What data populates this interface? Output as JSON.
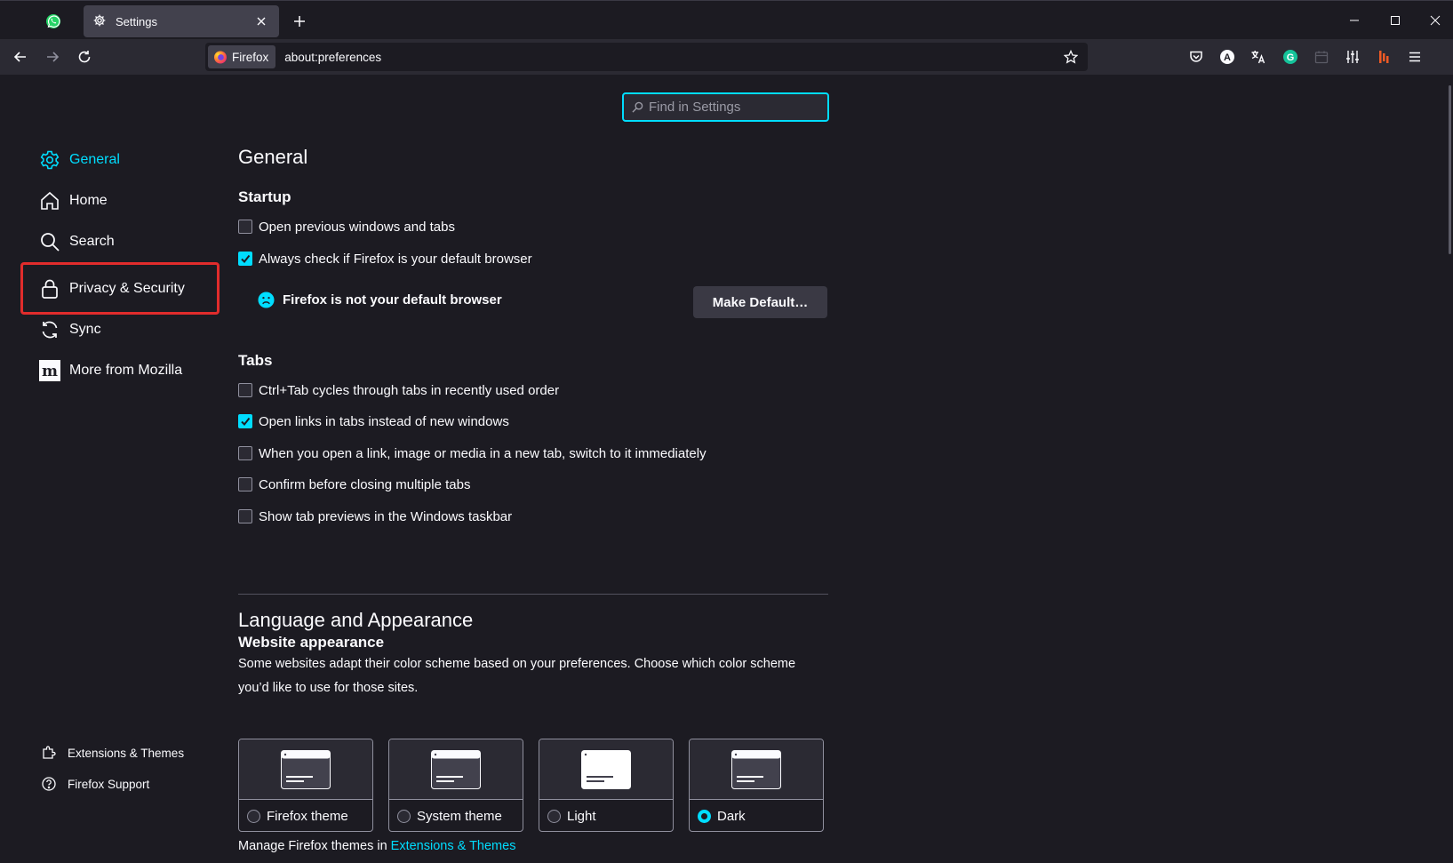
{
  "tabs": {
    "active_title": "Settings"
  },
  "urlbar": {
    "identity_label": "Firefox",
    "url": "about:preferences"
  },
  "search": {
    "placeholder": "Find in Settings"
  },
  "sidebar": {
    "items": [
      {
        "label": "General",
        "icon": "gear-icon",
        "selected": true
      },
      {
        "label": "Home",
        "icon": "home-icon"
      },
      {
        "label": "Search",
        "icon": "search-icon"
      },
      {
        "label": "Privacy & Security",
        "icon": "lock-icon"
      },
      {
        "label": "Sync",
        "icon": "sync-icon"
      },
      {
        "label": "More from Mozilla",
        "icon": "mozilla-icon"
      }
    ],
    "footer": [
      {
        "label": "Extensions & Themes",
        "icon": "puzzle-icon"
      },
      {
        "label": "Firefox Support",
        "icon": "help-icon"
      }
    ]
  },
  "general": {
    "title": "General",
    "startup": {
      "heading": "Startup",
      "open_previous": "Open previous windows and tabs",
      "open_previous_checked": false,
      "always_check": "Always check if Firefox is your default browser",
      "always_check_checked": true,
      "not_default_notice": "Firefox is not your default browser",
      "make_default_button": "Make Default…"
    },
    "tabs": {
      "heading": "Tabs",
      "options": [
        {
          "label": "Ctrl+Tab cycles through tabs in recently used order",
          "checked": false
        },
        {
          "label": "Open links in tabs instead of new windows",
          "checked": true
        },
        {
          "label": "When you open a link, image or media in a new tab, switch to it immediately",
          "checked": false
        },
        {
          "label": "Confirm before closing multiple tabs",
          "checked": false
        },
        {
          "label": "Show tab previews in the Windows taskbar",
          "checked": false
        }
      ]
    }
  },
  "language_appearance": {
    "title": "Language and Appearance",
    "website_appearance": {
      "heading": "Website appearance",
      "description": "Some websites adapt their color scheme based on your preferences. Choose which color scheme you’d like to use for those sites.",
      "themes": [
        {
          "label": "Firefox theme",
          "selected": false
        },
        {
          "label": "System theme",
          "selected": false
        },
        {
          "label": "Light",
          "selected": false
        },
        {
          "label": "Dark",
          "selected": true
        }
      ],
      "manage_prefix": "Manage Firefox themes in",
      "manage_link": "Extensions & Themes"
    }
  },
  "colors": {
    "accent": "#00ddff",
    "highlight": "#e12c2c",
    "background": "#1c1b22"
  }
}
